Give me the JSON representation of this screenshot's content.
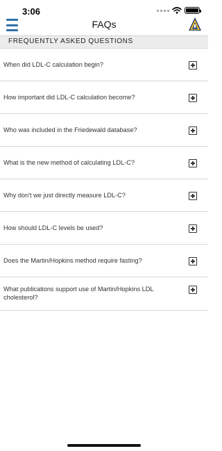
{
  "status_bar": {
    "time": "3:06"
  },
  "nav": {
    "title": "FAQs",
    "menu_icon": "hamburger-menu-icon",
    "logo_icon": "institution-shield-logo",
    "accent_color": "#2f6fa8"
  },
  "section": {
    "header": "FREQUENTLY ASKED QUESTIONS"
  },
  "faqs": [
    {
      "question": "When did LDL-C calculation begin?"
    },
    {
      "question": "How important did LDL-C calculation become?"
    },
    {
      "question": "Who was included in the Friedewald database?"
    },
    {
      "question": "What is the new method of calculating LDL-C?"
    },
    {
      "question": "Why don't we just directly measure LDL-C?"
    },
    {
      "question": "How should LDL-C levels be used?"
    },
    {
      "question": "Does the Martin/Hopkins method require fasting?"
    },
    {
      "question": "What publications support use of Martin/Hopkins LDL cholesterol?"
    }
  ]
}
